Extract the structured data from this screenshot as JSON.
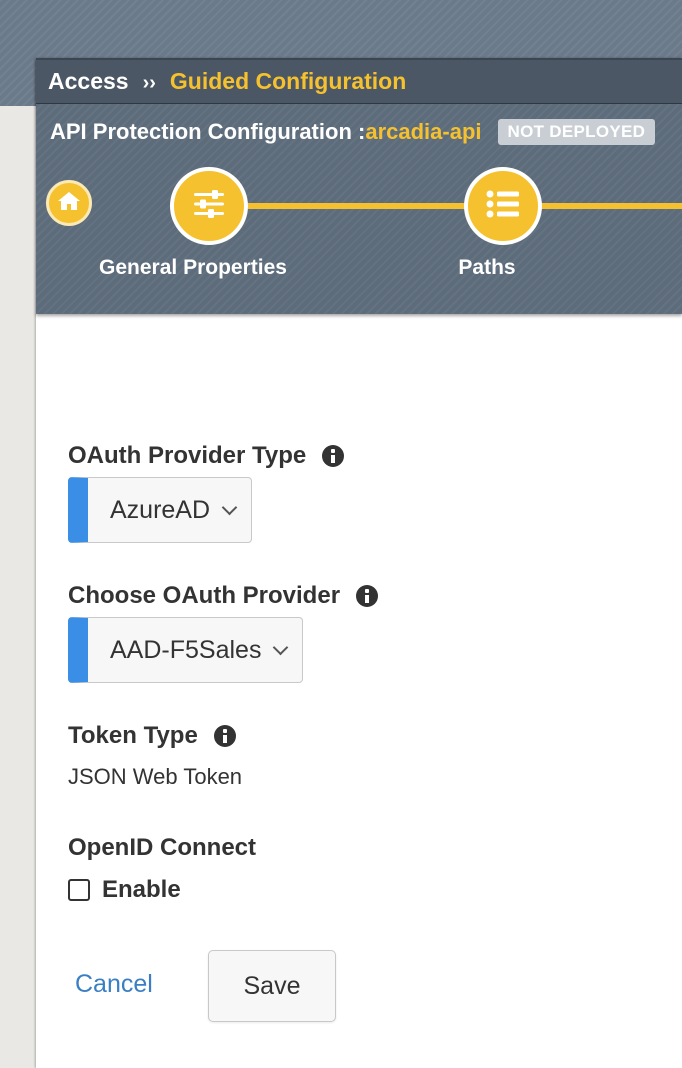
{
  "breadcrumb": {
    "parent": "Access",
    "separator": "››",
    "current": "Guided Configuration"
  },
  "config": {
    "label": "API Protection Configuration :",
    "name": "arcadia-api",
    "status": "NOT DEPLOYED"
  },
  "wizard": {
    "home_icon": "home-icon",
    "steps": [
      {
        "label": "General Properties",
        "icon": "sliders-icon"
      },
      {
        "label": "Paths",
        "icon": "list-icon"
      }
    ]
  },
  "form": {
    "oauth_provider_type": {
      "label": "OAuth Provider Type",
      "value": "AzureAD"
    },
    "oauth_provider": {
      "label": "Choose OAuth Provider",
      "value": "AAD-F5Sales"
    },
    "token_type": {
      "label": "Token Type",
      "value": "JSON Web Token"
    },
    "openid_connect": {
      "label": "OpenID Connect",
      "checkbox_label": "Enable",
      "checked": false
    }
  },
  "actions": {
    "cancel": "Cancel",
    "save": "Save"
  },
  "colors": {
    "accent": "#f5c12e",
    "select_accent": "#3a8ee6",
    "link": "#3a7fc4",
    "header": "#5d6c7b"
  }
}
